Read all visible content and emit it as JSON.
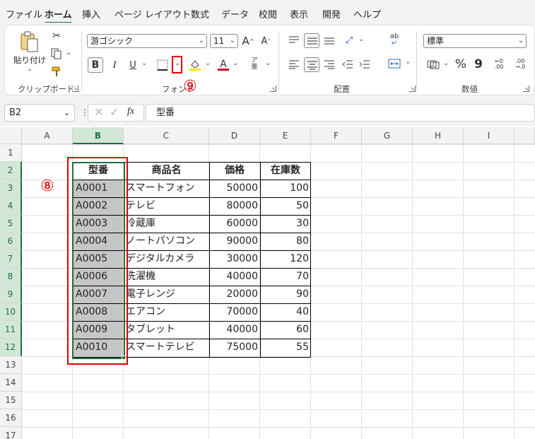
{
  "menu": {
    "tabs": [
      "ファイル",
      "ホーム",
      "挿入",
      "ページ レイアウト",
      "数式",
      "データ",
      "校閲",
      "表示",
      "開発",
      "ヘルプ"
    ],
    "active": "ホーム"
  },
  "ribbon": {
    "clipboard": {
      "paste_label": "貼り付け",
      "group_label": "クリップボード"
    },
    "font": {
      "font_name": "游ゴシック",
      "font_size": "11",
      "grow": "A",
      "shrink": "A",
      "bold": "B",
      "italic": "I",
      "underline": "U",
      "font_color_glyph": "A",
      "group_label": "フォント"
    },
    "alignment": {
      "group_label": "配置"
    },
    "number": {
      "format": "標準",
      "percent": "%",
      "comma": "9",
      "inc_dec": [
        "←0\n.00",
        ".00\n→.0"
      ],
      "group_label": "数値"
    }
  },
  "annotations": {
    "step8": "⑧",
    "step9": "⑨"
  },
  "formula_bar": {
    "name_box": "B2",
    "fx": "fx",
    "content": "型番"
  },
  "columns": [
    "A",
    "B",
    "C",
    "D",
    "E",
    "F",
    "G",
    "H",
    "I"
  ],
  "rows": [
    "1",
    "2",
    "3",
    "4",
    "5",
    "6",
    "7",
    "8",
    "9",
    "10",
    "11",
    "12",
    "13",
    "14",
    "15",
    "16",
    "17"
  ],
  "table": {
    "headers": [
      "型番",
      "商品名",
      "価格",
      "在庫数"
    ],
    "rows": [
      [
        "A0001",
        "スマートフォン",
        "50000",
        "100"
      ],
      [
        "A0002",
        "テレビ",
        "80000",
        "50"
      ],
      [
        "A0003",
        "冷蔵庫",
        "60000",
        "30"
      ],
      [
        "A0004",
        "ノートパソコン",
        "90000",
        "80"
      ],
      [
        "A0005",
        "デジタルカメラ",
        "30000",
        "120"
      ],
      [
        "A0006",
        "洗濯機",
        "40000",
        "70"
      ],
      [
        "A0007",
        "電子レンジ",
        "20000",
        "90"
      ],
      [
        "A0008",
        "エアコン",
        "70000",
        "40"
      ],
      [
        "A0009",
        "タブレット",
        "40000",
        "60"
      ],
      [
        "A0010",
        "スマートテレビ",
        "75000",
        "55"
      ]
    ]
  },
  "colors": {
    "excel_green": "#1e7145",
    "selection_fill": "#c6c6c6",
    "annotation_red": "#e00000"
  }
}
